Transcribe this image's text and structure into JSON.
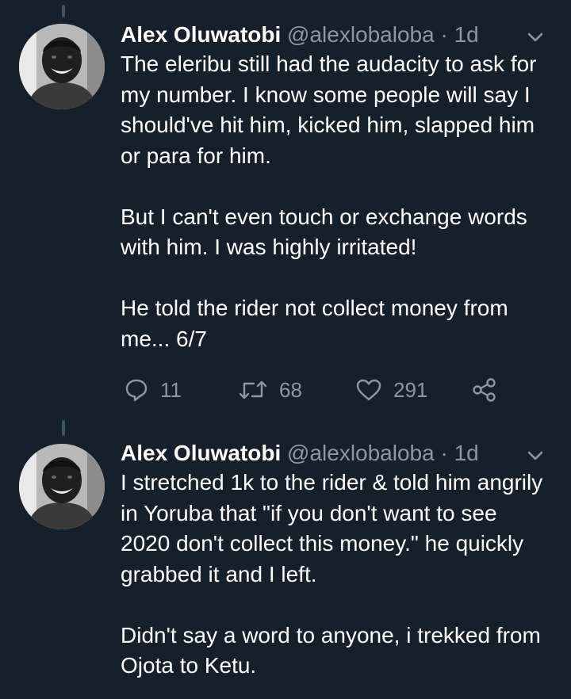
{
  "tweets": [
    {
      "name": "Alex Oluwatobi",
      "handle": "@alexlobaloba",
      "separator": "·",
      "time": "1d",
      "text": "The eleribu still had the audacity to ask for my number. I know some people will say I should've hit him, kicked him, slapped him or para for him.\n\nBut I can't even touch or exchange words with him. I was highly irritated!\n\nHe told the rider not collect money from me... 6/7",
      "replies": "11",
      "retweets": "68",
      "likes": "291"
    },
    {
      "name": "Alex Oluwatobi",
      "handle": "@alexlobaloba",
      "separator": "·",
      "time": "1d",
      "text": "I stretched 1k to the rider & told him angrily in Yoruba that \"if you don't want to see 2020 don't collect this money.\" he quickly grabbed it and I left.\n\nDidn't say a word to anyone, i trekked from Ojota to Ketu."
    }
  ],
  "colors": {
    "background": "#15202b",
    "text": "#ffffff",
    "secondary": "#8899a6",
    "thread_line": "#3d5466"
  },
  "icons": [
    "reply-icon",
    "retweet-icon",
    "like-icon",
    "share-icon",
    "chevron-down-icon"
  ]
}
